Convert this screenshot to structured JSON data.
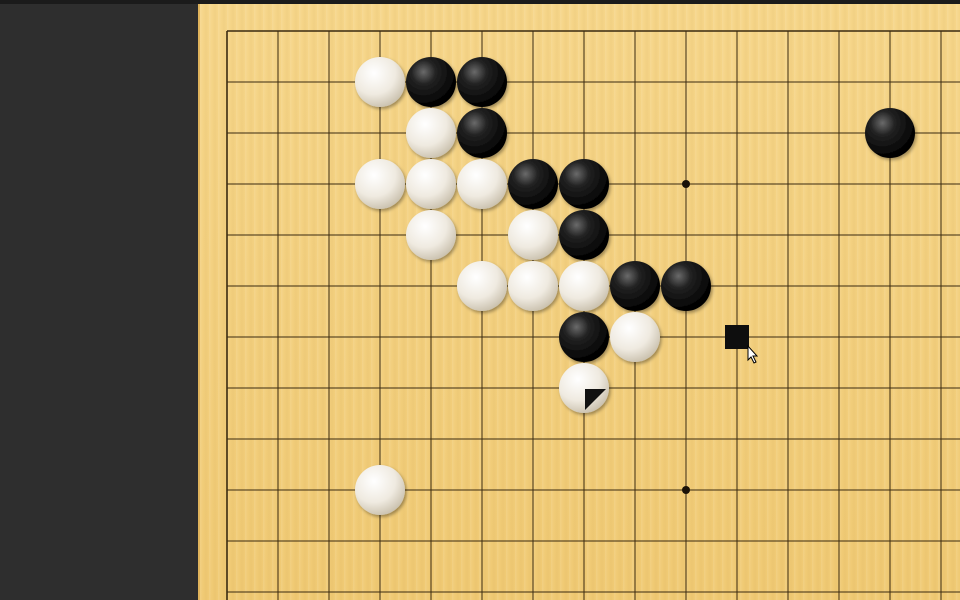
{
  "board": {
    "grid_rows": 12,
    "grid_cols": 15,
    "star_points": [
      [
        9,
        3
      ],
      [
        9,
        9
      ]
    ],
    "stones": [
      {
        "color": "white",
        "col": 3,
        "row": 1
      },
      {
        "color": "black",
        "col": 4,
        "row": 1
      },
      {
        "color": "black",
        "col": 5,
        "row": 1
      },
      {
        "color": "white",
        "col": 4,
        "row": 2
      },
      {
        "color": "black",
        "col": 5,
        "row": 2
      },
      {
        "color": "white",
        "col": 3,
        "row": 3
      },
      {
        "color": "white",
        "col": 4,
        "row": 3
      },
      {
        "color": "white",
        "col": 5,
        "row": 3
      },
      {
        "color": "black",
        "col": 6,
        "row": 3
      },
      {
        "color": "black",
        "col": 7,
        "row": 3
      },
      {
        "color": "white",
        "col": 4,
        "row": 4
      },
      {
        "color": "white",
        "col": 6,
        "row": 4
      },
      {
        "color": "black",
        "col": 7,
        "row": 4
      },
      {
        "color": "white",
        "col": 5,
        "row": 5
      },
      {
        "color": "white",
        "col": 6,
        "row": 5
      },
      {
        "color": "white",
        "col": 7,
        "row": 5
      },
      {
        "color": "black",
        "col": 8,
        "row": 5
      },
      {
        "color": "black",
        "col": 9,
        "row": 5
      },
      {
        "color": "black",
        "col": 7,
        "row": 6
      },
      {
        "color": "white",
        "col": 8,
        "row": 6
      },
      {
        "color": "white",
        "col": 7,
        "row": 7,
        "last_move": true
      },
      {
        "color": "white",
        "col": 3,
        "row": 9
      },
      {
        "color": "black",
        "col": 13,
        "row": 2
      }
    ],
    "hover_marker": {
      "color": "black",
      "col": 10,
      "row": 6
    }
  },
  "colors": {
    "board": "#f2cf7e",
    "grid_line": "#3a2a10",
    "black_stone": "#111111",
    "white_stone": "#f4f1ea",
    "background": "#2d2d2d"
  },
  "icons": {
    "cursor": "arrow-cursor-icon",
    "last_move": "last-move-triangle-icon"
  }
}
